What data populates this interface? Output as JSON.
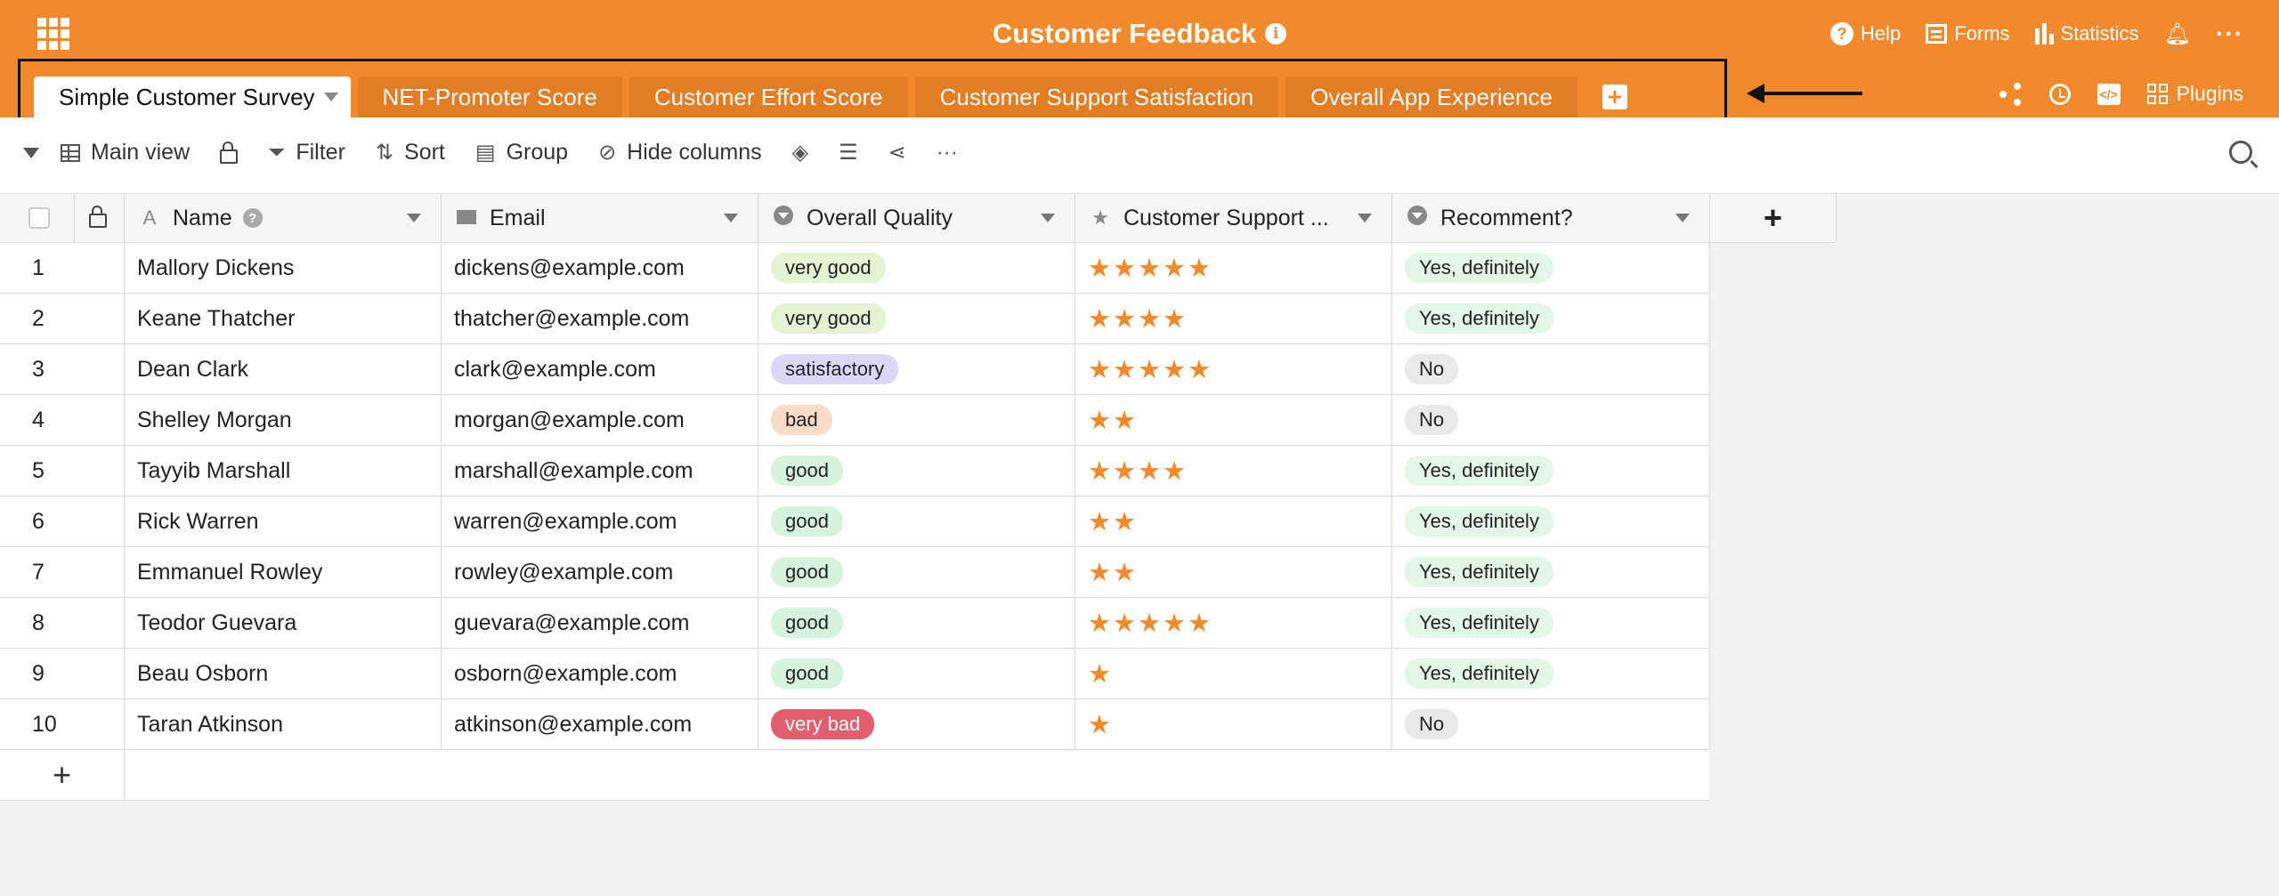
{
  "app": {
    "title": "Customer Feedback"
  },
  "top_nav": {
    "help": "Help",
    "forms": "Forms",
    "statistics": "Statistics"
  },
  "tabs": [
    {
      "label": "Simple Customer Survey",
      "active": true
    },
    {
      "label": "NET-Promoter Score"
    },
    {
      "label": "Customer Effort Score"
    },
    {
      "label": "Customer Support Satisfaction"
    },
    {
      "label": "Overall App Experience"
    }
  ],
  "tab_actions": {
    "plugins": "Plugins"
  },
  "toolbar": {
    "view": "Main view",
    "filter": "Filter",
    "sort": "Sort",
    "group": "Group",
    "hide_columns": "Hide columns"
  },
  "columns": [
    "Name",
    "Email",
    "Overall Quality",
    "Customer Support ...",
    "Recomment?"
  ],
  "rows": [
    {
      "n": "1",
      "name": "Mallory Dickens",
      "email": "dickens@example.com",
      "quality": "very good",
      "stars": 5,
      "rec": "Yes, definitely"
    },
    {
      "n": "2",
      "name": "Keane Thatcher",
      "email": "thatcher@example.com",
      "quality": "very good",
      "stars": 4,
      "rec": "Yes, definitely"
    },
    {
      "n": "3",
      "name": "Dean Clark",
      "email": "clark@example.com",
      "quality": "satisfactory",
      "stars": 5,
      "rec": "No"
    },
    {
      "n": "4",
      "name": "Shelley Morgan",
      "email": "morgan@example.com",
      "quality": "bad",
      "stars": 2,
      "rec": "No"
    },
    {
      "n": "5",
      "name": "Tayyib Marshall",
      "email": "marshall@example.com",
      "quality": "good",
      "stars": 4,
      "rec": "Yes, definitely"
    },
    {
      "n": "6",
      "name": "Rick Warren",
      "email": "warren@example.com",
      "quality": "good",
      "stars": 2,
      "rec": "Yes, definitely"
    },
    {
      "n": "7",
      "name": "Emmanuel Rowley",
      "email": "rowley@example.com",
      "quality": "good",
      "stars": 2,
      "rec": "Yes, definitely"
    },
    {
      "n": "8",
      "name": "Teodor Guevara",
      "email": "guevara@example.com",
      "quality": "good",
      "stars": 5,
      "rec": "Yes, definitely"
    },
    {
      "n": "9",
      "name": "Beau Osborn",
      "email": "osborn@example.com",
      "quality": "good",
      "stars": 1,
      "rec": "Yes, definitely"
    },
    {
      "n": "10",
      "name": "Taran Atkinson",
      "email": "atkinson@example.com",
      "quality": "very bad",
      "stars": 1,
      "rec": "No"
    }
  ],
  "colors": {
    "brand": "#f1892d",
    "very good": "#e3f3d3",
    "satisfactory": "#dcd6f7",
    "bad": "#f9dcc8",
    "good": "#d8f3dd",
    "very bad": "#e1606e",
    "yes": "#e2f7e6",
    "no": "#e9e9e9"
  }
}
